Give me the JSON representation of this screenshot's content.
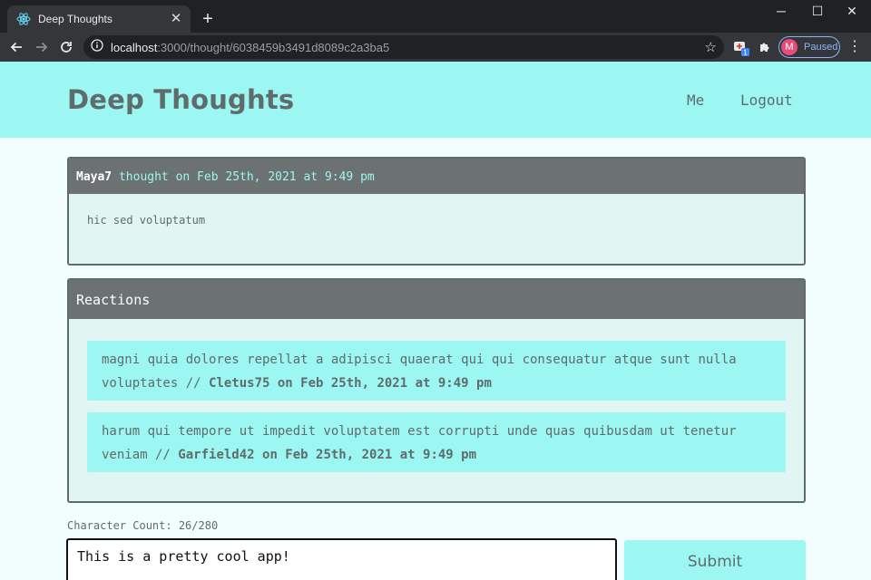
{
  "browser": {
    "tab_title": "Deep Thoughts",
    "url_host": "localhost",
    "url_path": ":3000/thought/6038459b3491d8089c2a3ba5",
    "profile_initial": "M",
    "profile_status": "Paused",
    "extension_badge": "1"
  },
  "header": {
    "brand": "Deep Thoughts",
    "nav": [
      "Me",
      "Logout"
    ]
  },
  "thought": {
    "username": "Maya7",
    "meta": " thought on Feb 25th, 2021 at 9:49 pm",
    "body": "hic sed voluptatum"
  },
  "reactions": {
    "title": "Reactions",
    "items": [
      {
        "body": "magni quia dolores repellat a adipisci quaerat qui qui consequatur atque sunt nulla voluptates // ",
        "byline": "Cletus75 on Feb 25th, 2021 at 9:49 pm"
      },
      {
        "body": "harum qui tempore ut impedit voluptatem est corrupti unde quas quibusdam ut tenetur veniam // ",
        "byline": "Garfield42 on Feb 25th, 2021 at 9:49 pm"
      }
    ]
  },
  "form": {
    "char_count": "Character Count: 26/280",
    "textarea_value": "This is a pretty cool app!",
    "submit_label": "Submit"
  },
  "colors": {
    "accent": "#9cf6f1",
    "dark": "#6c7272",
    "text": "#5f6c6c",
    "page_bg": "#f2fdfd"
  }
}
